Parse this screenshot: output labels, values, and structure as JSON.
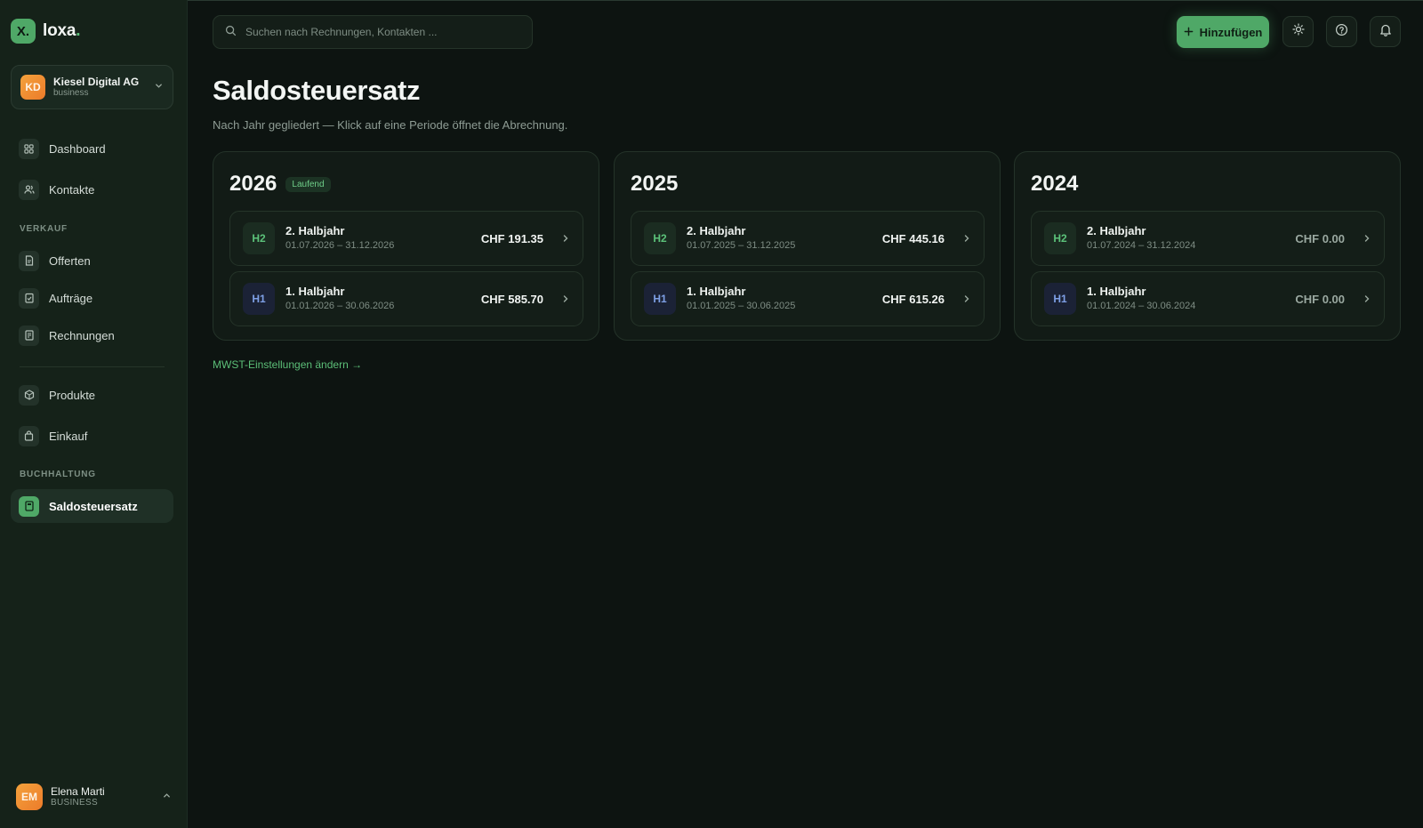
{
  "brand": {
    "mark": "X.",
    "name": "loxa",
    "dot": "."
  },
  "company": {
    "initials": "KD",
    "name": "Kiesel Digital AG",
    "type": "business"
  },
  "nav": {
    "dashboard": "Dashboard",
    "kontakte": "Kontakte",
    "section_verkauf": "VERKAUF",
    "offerten": "Offerten",
    "auftraege": "Aufträge",
    "rechnungen": "Rechnungen",
    "produkte": "Produkte",
    "einkauf": "Einkauf",
    "section_buchhaltung": "BUCHHALTUNG",
    "saldosteuersatz": "Saldosteuersatz"
  },
  "user": {
    "initials": "EM",
    "name": "Elena Marti",
    "role": "BUSINESS"
  },
  "search": {
    "placeholder": "Suchen nach Rechnungen, Kontakten ..."
  },
  "toolbar": {
    "add_label": "Hinzufügen"
  },
  "page": {
    "title": "Saldosteuersatz",
    "subtitle": "Nach Jahr gegliedert — Klick auf eine Periode öffnet die Abrechnung.",
    "settings_link": "MWST-Einstellungen ändern →"
  },
  "years": [
    {
      "year": "2026",
      "badge": "Laufend",
      "periods": [
        {
          "code": "H2",
          "name": "2. Halbjahr",
          "range": "01.07.2026 – 31.12.2026",
          "amount": "CHF 191.35"
        },
        {
          "code": "H1",
          "name": "1. Halbjahr",
          "range": "01.01.2026 – 30.06.2026",
          "amount": "CHF 585.70"
        }
      ]
    },
    {
      "year": "2025",
      "badge": "",
      "periods": [
        {
          "code": "H2",
          "name": "2. Halbjahr",
          "range": "01.07.2025 – 31.12.2025",
          "amount": "CHF 445.16"
        },
        {
          "code": "H1",
          "name": "1. Halbjahr",
          "range": "01.01.2025 – 30.06.2025",
          "amount": "CHF 615.26"
        }
      ]
    },
    {
      "year": "2024",
      "badge": "",
      "periods": [
        {
          "code": "H2",
          "name": "2. Halbjahr",
          "range": "01.07.2024 – 31.12.2024",
          "amount": "CHF 0.00"
        },
        {
          "code": "H1",
          "name": "1. Halbjahr",
          "range": "01.01.2024 – 30.06.2024",
          "amount": "CHF 0.00"
        }
      ]
    }
  ],
  "colors": {
    "accent": "#4fa867",
    "background": "#0d1411",
    "sidebar": "#152219"
  }
}
